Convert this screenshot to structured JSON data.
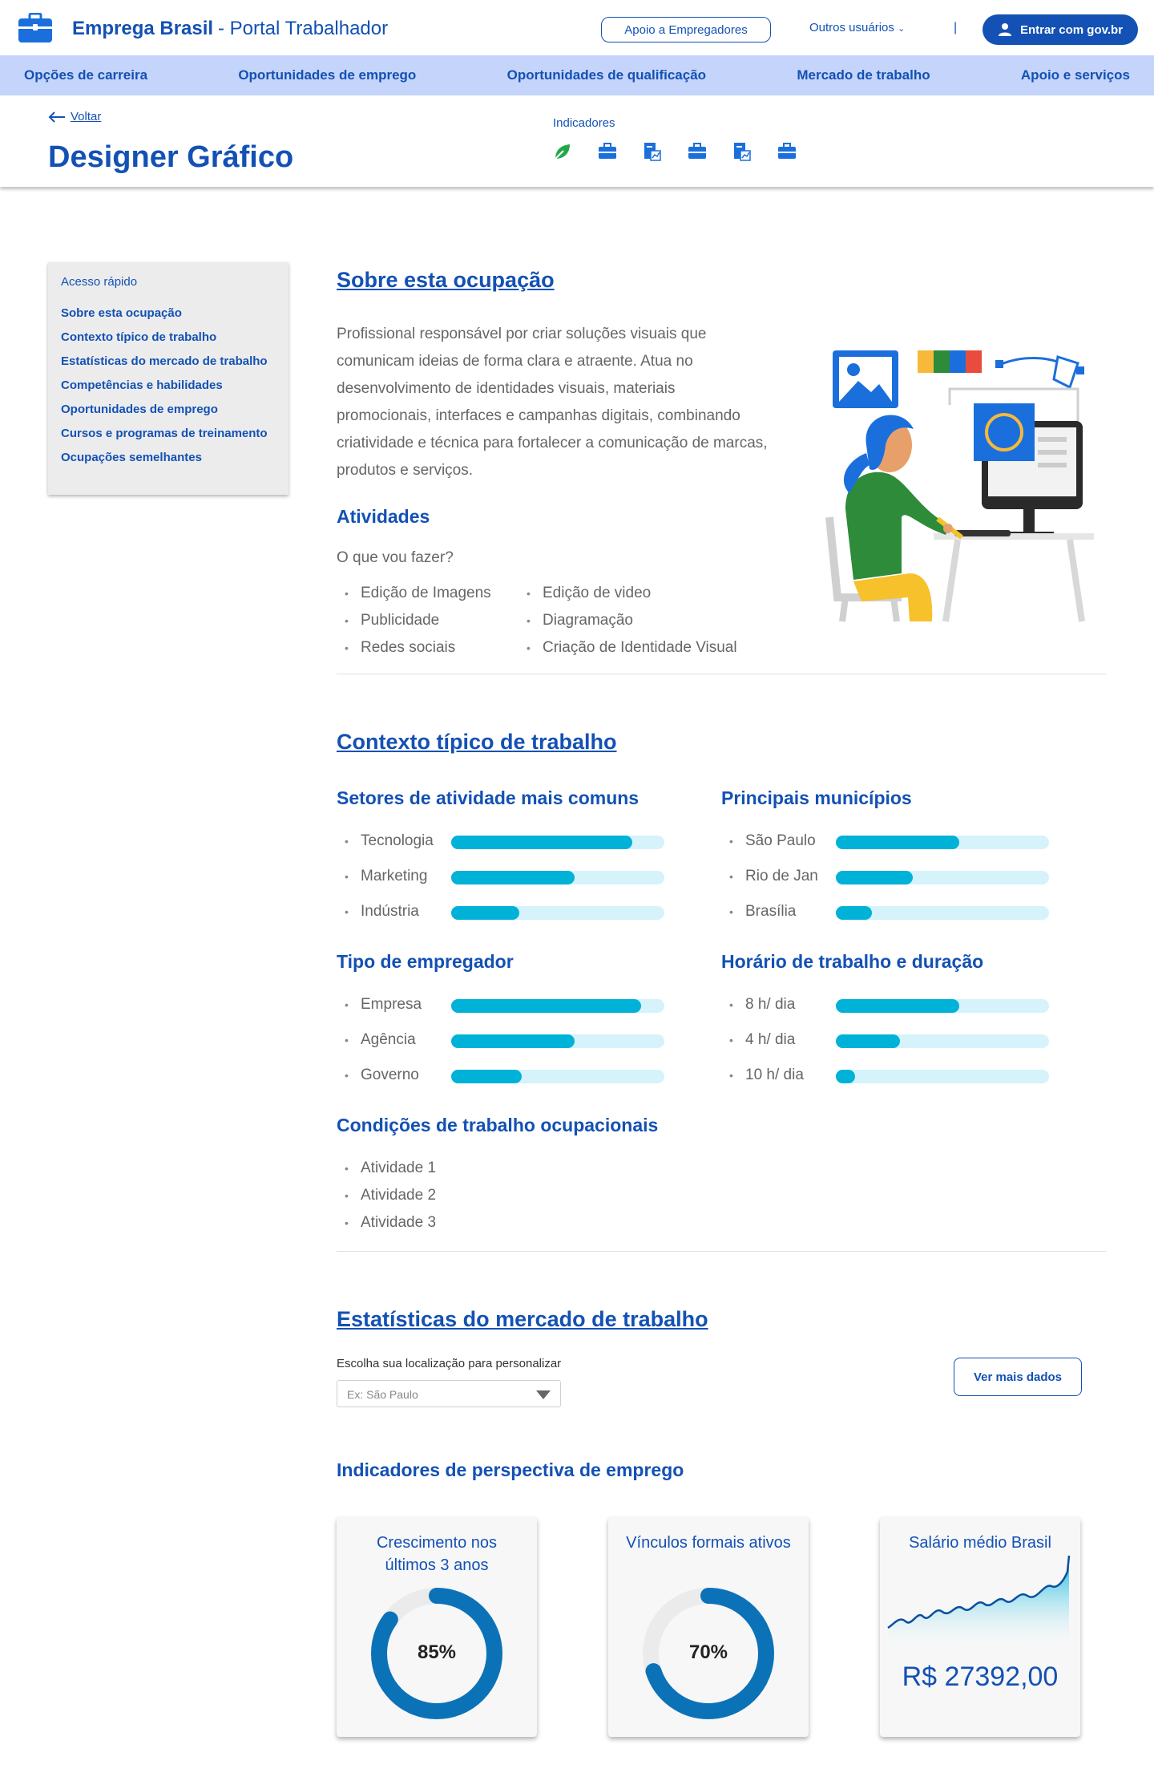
{
  "topbar": {
    "brand_name": "Emprega Brasil",
    "brand_sub": "- Portal Trabalhador",
    "employers_button": "Apoio a Empregadores",
    "other_users": "Outros usuários",
    "separator": "|",
    "login_button": "Entrar com gov.br"
  },
  "nav": {
    "items": [
      {
        "label": "Opções de carreira"
      },
      {
        "label": "Oportunidades de emprego"
      },
      {
        "label": "Oportunidades de qualificação"
      },
      {
        "label": "Mercado de trabalho"
      },
      {
        "label": "Apoio e serviços"
      }
    ]
  },
  "header": {
    "back_label": "Voltar",
    "title": "Designer Gráfico",
    "indicators_label": "Indicadores"
  },
  "sidebar": {
    "title": "Acesso rápido",
    "items": [
      {
        "label": "Sobre esta ocupação"
      },
      {
        "label": "Contexto típico de trabalho"
      },
      {
        "label": "Estatísticas do mercado de trabalho"
      },
      {
        "label": "Competências e habilidades"
      },
      {
        "label": "Oportunidades de emprego"
      },
      {
        "label": "Cursos e programas de treinamento"
      },
      {
        "label": "Ocupações semelhantes"
      }
    ]
  },
  "about": {
    "title": "Sobre esta ocupação",
    "description": "Profissional responsável por criar soluções visuais que comunicam ideias de forma clara e atraente. Atua no desenvolvimento de identidades visuais, materiais promocionais, interfaces e campanhas digitais, combinando criatividade e técnica para fortalecer a comunicação de marcas, produtos e serviços.",
    "activities_title": "Atividades",
    "activities_question": "O que vou fazer?",
    "activities_col1": [
      "Edição de Imagens",
      "Publicidade",
      "Redes sociais"
    ],
    "activities_col2": [
      "Edição de video",
      "Diagramação",
      "Criação de Identidade Visual"
    ]
  },
  "context": {
    "title": "Contexto típico de trabalho",
    "sectors": {
      "title": "Setores de atividade mais comuns",
      "items": [
        {
          "label": "Tecnologia",
          "value": 0.85
        },
        {
          "label": "Marketing",
          "value": 0.58
        },
        {
          "label": "Indústria",
          "value": 0.32
        }
      ]
    },
    "cities": {
      "title": "Principais municípios",
      "items": [
        {
          "label": "São Paulo",
          "value": 0.58
        },
        {
          "label": "Rio de Jan",
          "value": 0.36
        },
        {
          "label": "Brasília",
          "value": 0.17
        }
      ]
    },
    "employer": {
      "title": "Tipo de empregador",
      "items": [
        {
          "label": "Empresa",
          "value": 0.89
        },
        {
          "label": "Agência",
          "value": 0.58
        },
        {
          "label": "Governo",
          "value": 0.33
        }
      ]
    },
    "hours": {
      "title": "Horário de trabalho e duração",
      "items": [
        {
          "label": "8 h/ dia",
          "value": 0.58
        },
        {
          "label": "4 h/ dia",
          "value": 0.3
        },
        {
          "label": "10 h/ dia",
          "value": 0.09
        }
      ]
    },
    "conditions": {
      "title": "Condições de trabalho ocupacionais",
      "items": [
        "Atividade 1",
        "Atividade 2",
        "Atividade 3"
      ]
    }
  },
  "stats": {
    "title": "Estatísticas do mercado de trabalho",
    "location_label": "Escolha sua localização para personalizar",
    "location_placeholder": "Ex: São Paulo",
    "more_button": "Ver mais dados",
    "indicators_title": "Indicadores de perspectiva de emprego",
    "cards": [
      {
        "title": "Crescimento nos últimos 3 anos",
        "value": "85%",
        "percent": 85
      },
      {
        "title": "Vínculos formais ativos",
        "value": "70%",
        "percent": 70
      },
      {
        "title": "Salário médio Brasil",
        "value": "R$ 27392,00"
      }
    ]
  },
  "colors": {
    "primary": "#1351b4",
    "nav_bg": "#c5d4fb",
    "bar_fill": "#00b1d8",
    "bar_track": "#d6f2fa",
    "donut": "#0c72b8"
  }
}
